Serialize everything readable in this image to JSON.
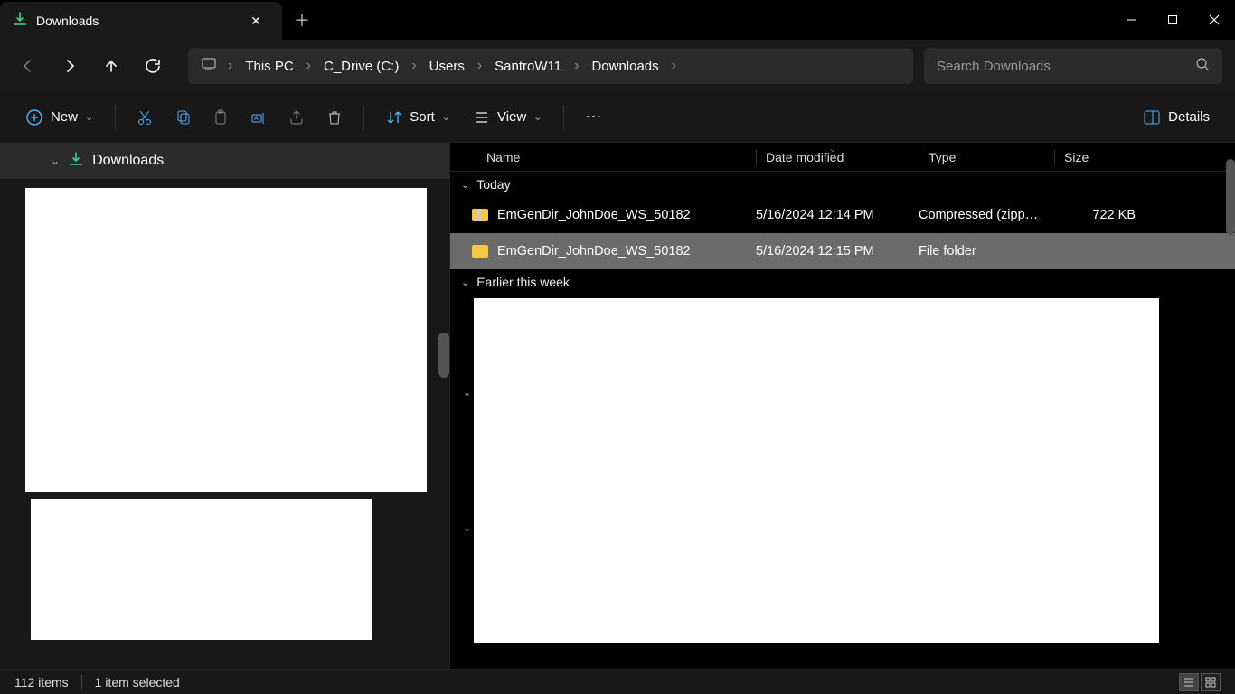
{
  "tab": {
    "title": "Downloads"
  },
  "breadcrumbs": [
    "This PC",
    "C_Drive (C:)",
    "Users",
    "SantroW11",
    "Downloads"
  ],
  "search": {
    "placeholder": "Search Downloads"
  },
  "toolbar": {
    "new_label": "New",
    "sort_label": "Sort",
    "view_label": "View",
    "details_label": "Details"
  },
  "sidebar": {
    "title": "Downloads"
  },
  "columns": {
    "name": "Name",
    "date": "Date modified",
    "type": "Type",
    "size": "Size"
  },
  "groups": {
    "today": "Today",
    "earlier_week": "Earlier this week"
  },
  "rows": [
    {
      "name": "EmGenDir_JohnDoe_WS_50182",
      "date": "5/16/2024 12:14 PM",
      "type": "Compressed (zipp…",
      "size": "722 KB",
      "icon": "zip",
      "selected": false
    },
    {
      "name": "EmGenDir_JohnDoe_WS_50182",
      "date": "5/16/2024 12:15 PM",
      "type": "File folder",
      "size": "",
      "icon": "folder",
      "selected": true
    }
  ],
  "status": {
    "items": "112 items",
    "selected": "1 item selected"
  }
}
